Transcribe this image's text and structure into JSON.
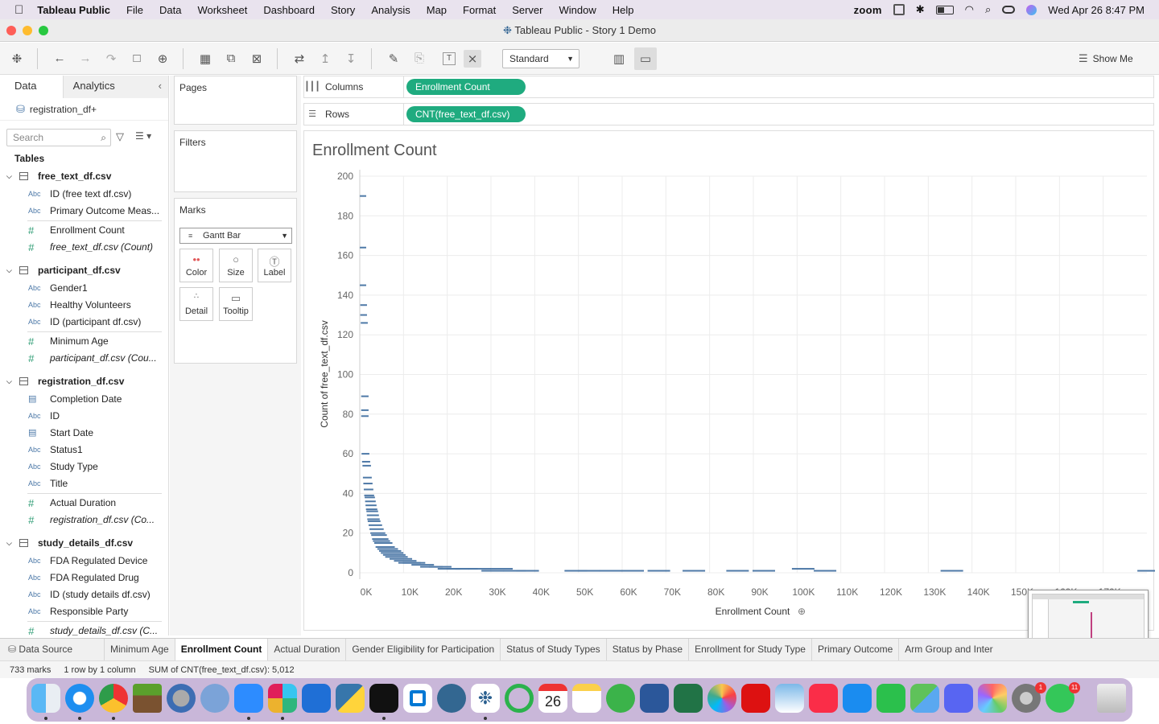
{
  "menubar": {
    "app": "Tableau Public",
    "items": [
      "File",
      "Data",
      "Worksheet",
      "Dashboard",
      "Story",
      "Analysis",
      "Map",
      "Format",
      "Server",
      "Window",
      "Help"
    ],
    "zoom": "zoom",
    "datetime": "Wed Apr 26  8:47 PM"
  },
  "window": {
    "title": "Tableau Public - Story 1 Demo"
  },
  "toolbar": {
    "view_mode": "Standard",
    "show_me": "Show Me"
  },
  "left": {
    "tab_data": "Data",
    "tab_analytics": "Analytics",
    "datasource": "registration_df+",
    "search_placeholder": "Search",
    "tables_label": "Tables",
    "tables": [
      {
        "name": "free_text_df.csv",
        "fields": [
          {
            "type": "Abc",
            "name": "ID (free text df.csv)"
          },
          {
            "type": "Abc",
            "name": "Primary Outcome Meas..."
          },
          {
            "type": "#",
            "name": "Enrollment Count"
          },
          {
            "type": "#",
            "name": "free_text_df.csv (Count)",
            "italic": true
          }
        ]
      },
      {
        "name": "participant_df.csv",
        "fields": [
          {
            "type": "Abc",
            "name": "Gender1"
          },
          {
            "type": "Abc",
            "name": "Healthy Volunteers"
          },
          {
            "type": "Abc",
            "name": "ID (participant df.csv)"
          },
          {
            "type": "#",
            "name": "Minimum Age"
          },
          {
            "type": "#",
            "name": "participant_df.csv (Cou...",
            "italic": true
          }
        ]
      },
      {
        "name": "registration_df.csv",
        "fields": [
          {
            "type": "date",
            "name": "Completion Date"
          },
          {
            "type": "Abc",
            "name": "ID"
          },
          {
            "type": "date",
            "name": "Start Date"
          },
          {
            "type": "Abc",
            "name": "Status1"
          },
          {
            "type": "Abc",
            "name": "Study Type"
          },
          {
            "type": "Abc",
            "name": "Title"
          },
          {
            "type": "#",
            "name": "Actual Duration"
          },
          {
            "type": "#",
            "name": "registration_df.csv (Co...",
            "italic": true
          }
        ]
      },
      {
        "name": "study_details_df.csv",
        "fields": [
          {
            "type": "Abc",
            "name": "FDA Regulated Device"
          },
          {
            "type": "Abc",
            "name": "FDA Regulated Drug"
          },
          {
            "type": "Abc",
            "name": "ID (study details df.csv)"
          },
          {
            "type": "Abc",
            "name": "Responsible Party"
          },
          {
            "type": "#",
            "name": "study_details_df.csv (C...",
            "italic": true
          }
        ]
      }
    ]
  },
  "cards": {
    "pages": "Pages",
    "filters": "Filters",
    "marks": "Marks",
    "mark_type": "Gantt Bar",
    "buttons": [
      "Color",
      "Size",
      "Label",
      "Detail",
      "Tooltip"
    ]
  },
  "shelves": {
    "columns_label": "Columns",
    "rows_label": "Rows",
    "columns_pill": "Enrollment Count",
    "rows_pill": "CNT(free_text_df.csv)"
  },
  "sheets": [
    "Data Source",
    "Minimum Age",
    "Enrollment Count",
    "Actual Duration",
    "Gender Eligibility for Participation",
    "Status of Study Types",
    "Status by Phase",
    "Enrollment for Study Type",
    "Primary Outcome",
    "Arm Group and Inter"
  ],
  "active_sheet": "Enrollment Count",
  "status": {
    "marks": "733 marks",
    "dims": "1 row by 1 column",
    "sum": "SUM of CNT(free_text_df.csv): 5,012"
  },
  "colors": {
    "accent": "#1fab7f",
    "mark": "#4e79a7",
    "dock": "#c9b7d9"
  },
  "chart_data": {
    "type": "gantt",
    "title": "Enrollment Count",
    "xlabel": "Enrollment Count",
    "ylabel": "Count of free_text_df.csv",
    "xlim": [
      0,
      180000
    ],
    "ylim": [
      0,
      200
    ],
    "x_ticks": [
      "0K",
      "10K",
      "20K",
      "30K",
      "40K",
      "50K",
      "60K",
      "70K",
      "80K",
      "90K",
      "100K",
      "110K",
      "120K",
      "130K",
      "140K",
      "150K",
      "160K",
      "170K"
    ],
    "y_ticks": [
      0,
      20,
      40,
      60,
      80,
      100,
      120,
      140,
      160,
      180,
      200
    ],
    "grid": true,
    "points": [
      [
        200,
        190
      ],
      [
        200,
        164
      ],
      [
        200,
        145
      ],
      [
        300,
        135
      ],
      [
        300,
        130
      ],
      [
        400,
        126
      ],
      [
        500,
        89
      ],
      [
        500,
        82
      ],
      [
        500,
        79
      ],
      [
        600,
        60
      ],
      [
        700,
        56
      ],
      [
        800,
        54
      ],
      [
        900,
        48
      ],
      [
        1000,
        45
      ],
      [
        1100,
        42
      ],
      [
        1200,
        39
      ],
      [
        1300,
        38
      ],
      [
        1400,
        36
      ],
      [
        1500,
        34
      ],
      [
        1600,
        32
      ],
      [
        1700,
        31
      ],
      [
        1800,
        29
      ],
      [
        1900,
        27
      ],
      [
        2000,
        26
      ],
      [
        2200,
        24
      ],
      [
        2400,
        22
      ],
      [
        2600,
        20
      ],
      [
        2800,
        19
      ],
      [
        3000,
        17
      ],
      [
        3200,
        16
      ],
      [
        3500,
        15
      ],
      [
        3800,
        13
      ],
      [
        4200,
        12
      ],
      [
        4600,
        11
      ],
      [
        5000,
        10
      ],
      [
        5500,
        9
      ],
      [
        6000,
        8
      ],
      [
        7000,
        7
      ],
      [
        8000,
        6
      ],
      [
        9000,
        5
      ],
      [
        10000,
        5
      ],
      [
        12000,
        4
      ],
      [
        14000,
        3
      ],
      [
        16000,
        3
      ],
      [
        18000,
        2
      ],
      [
        20000,
        2
      ],
      [
        22000,
        2
      ],
      [
        25000,
        2
      ],
      [
        28000,
        1
      ],
      [
        30000,
        2
      ],
      [
        33000,
        1
      ],
      [
        36000,
        1
      ],
      [
        47000,
        1
      ],
      [
        50000,
        1
      ],
      [
        55000,
        1
      ],
      [
        60000,
        1
      ],
      [
        66000,
        1
      ],
      [
        74000,
        1
      ],
      [
        84000,
        1
      ],
      [
        90000,
        1
      ],
      [
        99000,
        2
      ],
      [
        104000,
        1
      ],
      [
        133000,
        1
      ],
      [
        178000,
        1
      ]
    ]
  }
}
